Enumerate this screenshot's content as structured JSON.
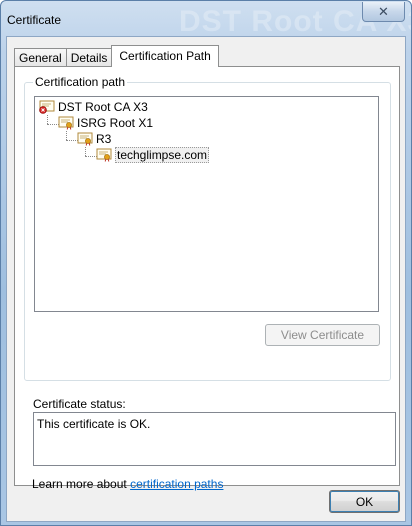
{
  "window": {
    "title": "Certificate",
    "watermark_text": "DST Root CA X3",
    "close_glyph": "✕"
  },
  "tabs": [
    {
      "label": "General",
      "active": false
    },
    {
      "label": "Details",
      "active": false
    },
    {
      "label": "Certification Path",
      "active": true
    }
  ],
  "certification_path": {
    "group_label": "Certification path",
    "nodes": [
      {
        "label": "DST Root CA X3",
        "level": 0,
        "icon": "certificate-error-icon"
      },
      {
        "label": "ISRG Root X1",
        "level": 1,
        "icon": "certificate-icon"
      },
      {
        "label": "R3",
        "level": 2,
        "icon": "certificate-icon"
      },
      {
        "label": "techglimpse.com",
        "level": 3,
        "icon": "certificate-icon",
        "selected": true
      }
    ],
    "view_button": "View Certificate"
  },
  "status": {
    "label": "Certificate status:",
    "text": "This certificate is OK."
  },
  "learn_more": {
    "prefix": "Learn more about ",
    "link": "certification paths"
  },
  "footer": {
    "ok_label": "OK"
  },
  "colors": {
    "link": "#0066cc",
    "frame": "#a9c6e4",
    "disabled_text": "#8d8d8d"
  }
}
